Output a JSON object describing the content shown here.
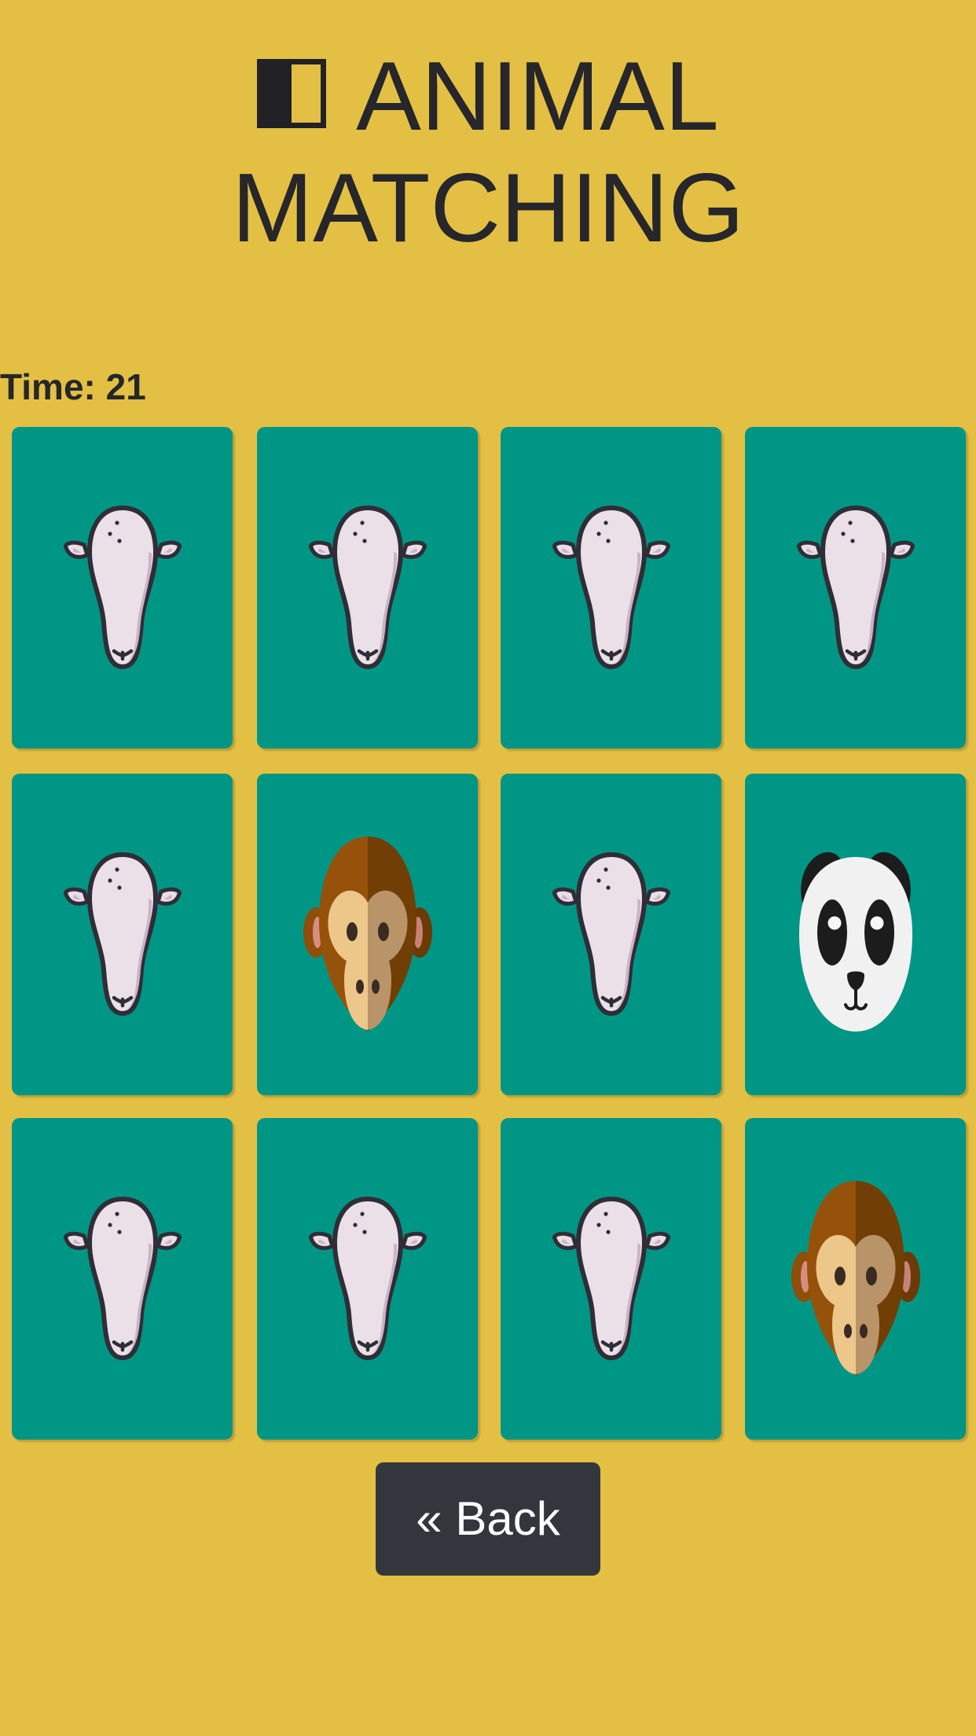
{
  "header": {
    "logo_icon": "half-filled-square-icon",
    "title": "ANIMAL MATCHING"
  },
  "timer": {
    "text": "Time: 21"
  },
  "board": {
    "rows": 3,
    "columns": 4,
    "card_color": "#009685",
    "background_color": "#e3c043",
    "cards": [
      {
        "state": "hidden",
        "face": "cow-icon"
      },
      {
        "state": "hidden",
        "face": "cow-icon"
      },
      {
        "state": "hidden",
        "face": "cow-icon"
      },
      {
        "state": "hidden",
        "face": "cow-icon"
      },
      {
        "state": "hidden",
        "face": "cow-icon"
      },
      {
        "state": "revealed",
        "face": "monkey-icon"
      },
      {
        "state": "hidden",
        "face": "cow-icon"
      },
      {
        "state": "revealed",
        "face": "panda-icon"
      },
      {
        "state": "hidden",
        "face": "cow-icon"
      },
      {
        "state": "hidden",
        "face": "cow-icon"
      },
      {
        "state": "hidden",
        "face": "cow-icon"
      },
      {
        "state": "revealed",
        "face": "monkey-icon"
      }
    ]
  },
  "back_button": {
    "label": "« Back",
    "color": "#33373d"
  }
}
